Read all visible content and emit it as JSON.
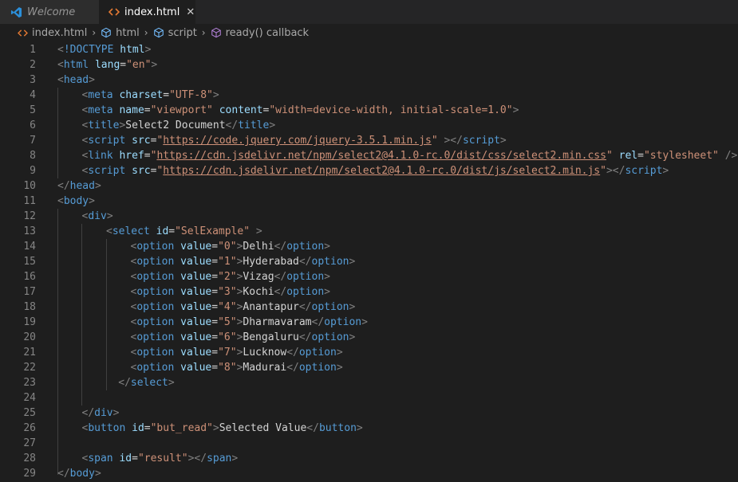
{
  "tabs": [
    {
      "label": "Welcome",
      "active": false,
      "icon": "vscode-icon"
    },
    {
      "label": "index.html",
      "active": true,
      "icon": "html-file-icon"
    }
  ],
  "breadcrumb": [
    "index.html",
    "html",
    "script",
    "ready() callback"
  ],
  "colors": {
    "tag": "#569cd6",
    "attr": "#9cdcfe",
    "string": "#ce9178",
    "punct": "#808080",
    "text": "#d4d4d4",
    "line_number": "#858585",
    "background": "#1e1e1e"
  },
  "code_lines": [
    {
      "num": "1",
      "indent": 0,
      "tokens": [
        [
          "p",
          "<"
        ],
        [
          "t",
          "!DOCTYPE"
        ],
        [
          "x",
          " "
        ],
        [
          "a",
          "html"
        ],
        [
          "p",
          ">"
        ]
      ]
    },
    {
      "num": "2",
      "indent": 0,
      "tokens": [
        [
          "p",
          "<"
        ],
        [
          "t",
          "html"
        ],
        [
          "x",
          " "
        ],
        [
          "a",
          "lang"
        ],
        [
          "x",
          "="
        ],
        [
          "s",
          "\"en\""
        ],
        [
          "p",
          ">"
        ]
      ]
    },
    {
      "num": "3",
      "indent": 0,
      "tokens": [
        [
          "p",
          "<"
        ],
        [
          "t",
          "head"
        ],
        [
          "p",
          ">"
        ]
      ]
    },
    {
      "num": "4",
      "indent": 1,
      "tokens": [
        [
          "p",
          "<"
        ],
        [
          "t",
          "meta"
        ],
        [
          "x",
          " "
        ],
        [
          "a",
          "charset"
        ],
        [
          "x",
          "="
        ],
        [
          "s",
          "\"UTF-8\""
        ],
        [
          "p",
          ">"
        ]
      ]
    },
    {
      "num": "5",
      "indent": 1,
      "tokens": [
        [
          "p",
          "<"
        ],
        [
          "t",
          "meta"
        ],
        [
          "x",
          " "
        ],
        [
          "a",
          "name"
        ],
        [
          "x",
          "="
        ],
        [
          "s",
          "\"viewport\""
        ],
        [
          "x",
          " "
        ],
        [
          "a",
          "content"
        ],
        [
          "x",
          "="
        ],
        [
          "s",
          "\"width=device-width, initial-scale=1.0\""
        ],
        [
          "p",
          ">"
        ]
      ]
    },
    {
      "num": "6",
      "indent": 1,
      "tokens": [
        [
          "p",
          "<"
        ],
        [
          "t",
          "title"
        ],
        [
          "p",
          ">"
        ],
        [
          "x",
          "Select2 Document"
        ],
        [
          "p",
          "</"
        ],
        [
          "t",
          "title"
        ],
        [
          "p",
          ">"
        ]
      ]
    },
    {
      "num": "7",
      "indent": 1,
      "tokens": [
        [
          "p",
          "<"
        ],
        [
          "t",
          "script"
        ],
        [
          "x",
          " "
        ],
        [
          "a",
          "src"
        ],
        [
          "x",
          "="
        ],
        [
          "s",
          "\""
        ],
        [
          "su",
          "https://code.jquery.com/jquery-3.5.1.min.js"
        ],
        [
          "s",
          "\""
        ],
        [
          "x",
          " "
        ],
        [
          "p",
          "></"
        ],
        [
          "t",
          "script"
        ],
        [
          "p",
          ">"
        ]
      ]
    },
    {
      "num": "8",
      "indent": 1,
      "tokens": [
        [
          "p",
          "<"
        ],
        [
          "t",
          "link"
        ],
        [
          "x",
          " "
        ],
        [
          "a",
          "href"
        ],
        [
          "x",
          "="
        ],
        [
          "s",
          "\""
        ],
        [
          "su",
          "https://cdn.jsdelivr.net/npm/select2@4.1.0-rc.0/dist/css/select2.min.css"
        ],
        [
          "s",
          "\""
        ],
        [
          "x",
          " "
        ],
        [
          "a",
          "rel"
        ],
        [
          "x",
          "="
        ],
        [
          "s",
          "\"stylesheet\""
        ],
        [
          "x",
          " "
        ],
        [
          "p",
          "/>"
        ]
      ]
    },
    {
      "num": "9",
      "indent": 1,
      "tokens": [
        [
          "p",
          "<"
        ],
        [
          "t",
          "script"
        ],
        [
          "x",
          " "
        ],
        [
          "a",
          "src"
        ],
        [
          "x",
          "="
        ],
        [
          "s",
          "\""
        ],
        [
          "su",
          "https://cdn.jsdelivr.net/npm/select2@4.1.0-rc.0/dist/js/select2.min.js"
        ],
        [
          "s",
          "\""
        ],
        [
          "p",
          "></"
        ],
        [
          "t",
          "script"
        ],
        [
          "p",
          ">"
        ]
      ]
    },
    {
      "num": "10",
      "indent": 0,
      "tokens": [
        [
          "p",
          "</"
        ],
        [
          "t",
          "head"
        ],
        [
          "p",
          ">"
        ]
      ]
    },
    {
      "num": "11",
      "indent": 0,
      "tokens": [
        [
          "p",
          "<"
        ],
        [
          "t",
          "body"
        ],
        [
          "p",
          ">"
        ]
      ]
    },
    {
      "num": "12",
      "indent": 1,
      "tokens": [
        [
          "p",
          "<"
        ],
        [
          "t",
          "div"
        ],
        [
          "p",
          ">"
        ]
      ]
    },
    {
      "num": "13",
      "indent": 2,
      "tokens": [
        [
          "p",
          "<"
        ],
        [
          "t",
          "select"
        ],
        [
          "x",
          " "
        ],
        [
          "a",
          "id"
        ],
        [
          "x",
          "="
        ],
        [
          "s",
          "\"SelExample\""
        ],
        [
          "x",
          " "
        ],
        [
          "p",
          ">"
        ]
      ]
    },
    {
      "num": "14",
      "indent": 3,
      "tokens": [
        [
          "p",
          "<"
        ],
        [
          "t",
          "option"
        ],
        [
          "x",
          " "
        ],
        [
          "a",
          "value"
        ],
        [
          "x",
          "="
        ],
        [
          "s",
          "\"0\""
        ],
        [
          "p",
          ">"
        ],
        [
          "x",
          "Delhi"
        ],
        [
          "p",
          "</"
        ],
        [
          "t",
          "option"
        ],
        [
          "p",
          ">"
        ]
      ]
    },
    {
      "num": "15",
      "indent": 3,
      "tokens": [
        [
          "p",
          "<"
        ],
        [
          "t",
          "option"
        ],
        [
          "x",
          " "
        ],
        [
          "a",
          "value"
        ],
        [
          "x",
          "="
        ],
        [
          "s",
          "\"1\""
        ],
        [
          "p",
          ">"
        ],
        [
          "x",
          "Hyderabad"
        ],
        [
          "p",
          "</"
        ],
        [
          "t",
          "option"
        ],
        [
          "p",
          ">"
        ]
      ]
    },
    {
      "num": "16",
      "indent": 3,
      "tokens": [
        [
          "p",
          "<"
        ],
        [
          "t",
          "option"
        ],
        [
          "x",
          " "
        ],
        [
          "a",
          "value"
        ],
        [
          "x",
          "="
        ],
        [
          "s",
          "\"2\""
        ],
        [
          "p",
          ">"
        ],
        [
          "x",
          "Vizag"
        ],
        [
          "p",
          "</"
        ],
        [
          "t",
          "option"
        ],
        [
          "p",
          ">"
        ]
      ]
    },
    {
      "num": "17",
      "indent": 3,
      "tokens": [
        [
          "p",
          "<"
        ],
        [
          "t",
          "option"
        ],
        [
          "x",
          " "
        ],
        [
          "a",
          "value"
        ],
        [
          "x",
          "="
        ],
        [
          "s",
          "\"3\""
        ],
        [
          "p",
          ">"
        ],
        [
          "x",
          "Kochi"
        ],
        [
          "p",
          "</"
        ],
        [
          "t",
          "option"
        ],
        [
          "p",
          ">"
        ]
      ]
    },
    {
      "num": "18",
      "indent": 3,
      "tokens": [
        [
          "p",
          "<"
        ],
        [
          "t",
          "option"
        ],
        [
          "x",
          " "
        ],
        [
          "a",
          "value"
        ],
        [
          "x",
          "="
        ],
        [
          "s",
          "\"4\""
        ],
        [
          "p",
          ">"
        ],
        [
          "x",
          "Anantapur"
        ],
        [
          "p",
          "</"
        ],
        [
          "t",
          "option"
        ],
        [
          "p",
          ">"
        ]
      ]
    },
    {
      "num": "19",
      "indent": 3,
      "tokens": [
        [
          "p",
          "<"
        ],
        [
          "t",
          "option"
        ],
        [
          "x",
          " "
        ],
        [
          "a",
          "value"
        ],
        [
          "x",
          "="
        ],
        [
          "s",
          "\"5\""
        ],
        [
          "p",
          ">"
        ],
        [
          "x",
          "Dharmavaram"
        ],
        [
          "p",
          "</"
        ],
        [
          "t",
          "option"
        ],
        [
          "p",
          ">"
        ]
      ]
    },
    {
      "num": "20",
      "indent": 3,
      "tokens": [
        [
          "p",
          "<"
        ],
        [
          "t",
          "option"
        ],
        [
          "x",
          " "
        ],
        [
          "a",
          "value"
        ],
        [
          "x",
          "="
        ],
        [
          "s",
          "\"6\""
        ],
        [
          "p",
          ">"
        ],
        [
          "x",
          "Bengaluru"
        ],
        [
          "p",
          "</"
        ],
        [
          "t",
          "option"
        ],
        [
          "p",
          ">"
        ]
      ]
    },
    {
      "num": "21",
      "indent": 3,
      "tokens": [
        [
          "p",
          "<"
        ],
        [
          "t",
          "option"
        ],
        [
          "x",
          " "
        ],
        [
          "a",
          "value"
        ],
        [
          "x",
          "="
        ],
        [
          "s",
          "\"7\""
        ],
        [
          "p",
          ">"
        ],
        [
          "x",
          "Lucknow"
        ],
        [
          "p",
          "</"
        ],
        [
          "t",
          "option"
        ],
        [
          "p",
          ">"
        ]
      ]
    },
    {
      "num": "22",
      "indent": 3,
      "tokens": [
        [
          "p",
          "<"
        ],
        [
          "t",
          "option"
        ],
        [
          "x",
          " "
        ],
        [
          "a",
          "value"
        ],
        [
          "x",
          "="
        ],
        [
          "s",
          "\"8\""
        ],
        [
          "p",
          ">"
        ],
        [
          "x",
          "Madurai"
        ],
        [
          "p",
          "</"
        ],
        [
          "t",
          "option"
        ],
        [
          "p",
          ">"
        ]
      ]
    },
    {
      "num": "23",
      "indent": 2.5,
      "tokens": [
        [
          "p",
          "</"
        ],
        [
          "t",
          "select"
        ],
        [
          "p",
          ">"
        ]
      ]
    },
    {
      "num": "24",
      "indent": 0,
      "tokens": []
    },
    {
      "num": "25",
      "indent": 1,
      "tokens": [
        [
          "p",
          "</"
        ],
        [
          "t",
          "div"
        ],
        [
          "p",
          ">"
        ]
      ]
    },
    {
      "num": "26",
      "indent": 1,
      "tokens": [
        [
          "p",
          "<"
        ],
        [
          "t",
          "button"
        ],
        [
          "x",
          " "
        ],
        [
          "a",
          "id"
        ],
        [
          "x",
          "="
        ],
        [
          "s",
          "\"but_read\""
        ],
        [
          "p",
          ">"
        ],
        [
          "x",
          "Selected Value"
        ],
        [
          "p",
          "</"
        ],
        [
          "t",
          "button"
        ],
        [
          "p",
          ">"
        ]
      ]
    },
    {
      "num": "27",
      "indent": 0,
      "tokens": []
    },
    {
      "num": "28",
      "indent": 1,
      "tokens": [
        [
          "p",
          "<"
        ],
        [
          "t",
          "span"
        ],
        [
          "x",
          " "
        ],
        [
          "a",
          "id"
        ],
        [
          "x",
          "="
        ],
        [
          "s",
          "\"result\""
        ],
        [
          "p",
          "></"
        ],
        [
          "t",
          "span"
        ],
        [
          "p",
          ">"
        ]
      ]
    },
    {
      "num": "29",
      "indent": 0,
      "tokens": [
        [
          "p",
          "</"
        ],
        [
          "t",
          "body"
        ],
        [
          "p",
          ">"
        ]
      ]
    }
  ]
}
